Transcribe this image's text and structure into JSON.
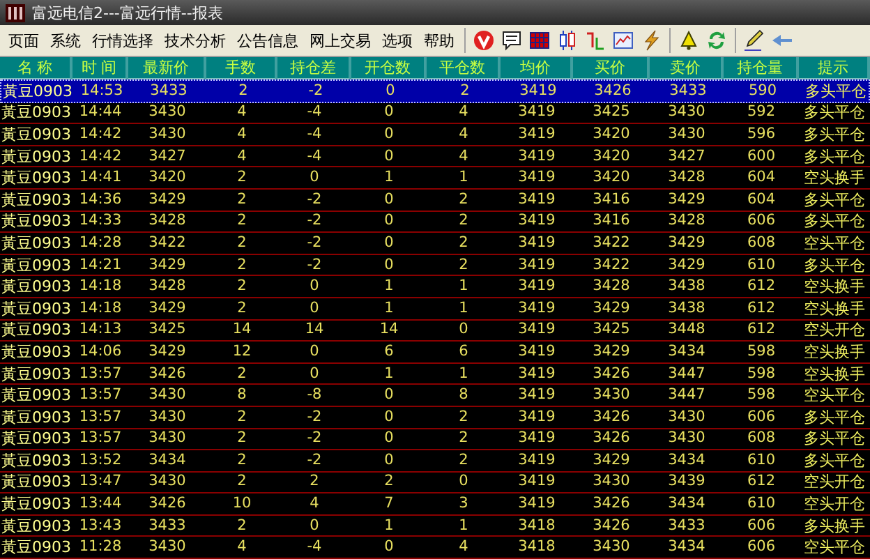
{
  "window": {
    "title": "富远电信2---富远行情--报表"
  },
  "menu": [
    "页面",
    "系统",
    "行情选择",
    "技术分析",
    "公告信息",
    "网上交易",
    "选项",
    "帮助"
  ],
  "table": {
    "columns": [
      "名 称",
      "时 间",
      "最新价",
      "手数",
      "持仓差",
      "开仓数",
      "平仓数",
      "均价",
      "买价",
      "卖价",
      "持仓量",
      "提示"
    ],
    "rows": [
      {
        "selected": true,
        "cells": [
          "黃豆0903",
          "14:53",
          "3433",
          "2",
          "-2",
          "0",
          "2",
          "3419",
          "3426",
          "3433",
          "590",
          "多头平仓"
        ]
      },
      {
        "selected": false,
        "cells": [
          "黃豆0903",
          "14:44",
          "3430",
          "4",
          "-4",
          "0",
          "4",
          "3419",
          "3425",
          "3430",
          "592",
          "多头平仓"
        ]
      },
      {
        "selected": false,
        "cells": [
          "黃豆0903",
          "14:42",
          "3430",
          "4",
          "-4",
          "0",
          "4",
          "3419",
          "3420",
          "3430",
          "596",
          "多头平仓"
        ]
      },
      {
        "selected": false,
        "cells": [
          "黃豆0903",
          "14:42",
          "3427",
          "4",
          "-4",
          "0",
          "4",
          "3419",
          "3420",
          "3427",
          "600",
          "多头平仓"
        ]
      },
      {
        "selected": false,
        "cells": [
          "黃豆0903",
          "14:41",
          "3420",
          "2",
          "0",
          "1",
          "1",
          "3419",
          "3420",
          "3428",
          "604",
          "空头换手"
        ]
      },
      {
        "selected": false,
        "cells": [
          "黃豆0903",
          "14:36",
          "3429",
          "2",
          "-2",
          "0",
          "2",
          "3419",
          "3416",
          "3429",
          "604",
          "多头平仓"
        ]
      },
      {
        "selected": false,
        "cells": [
          "黃豆0903",
          "14:33",
          "3428",
          "2",
          "-2",
          "0",
          "2",
          "3419",
          "3416",
          "3428",
          "606",
          "多头平仓"
        ]
      },
      {
        "selected": false,
        "cells": [
          "黃豆0903",
          "14:28",
          "3422",
          "2",
          "-2",
          "0",
          "2",
          "3419",
          "3422",
          "3429",
          "608",
          "空头平仓"
        ]
      },
      {
        "selected": false,
        "cells": [
          "黃豆0903",
          "14:21",
          "3429",
          "2",
          "-2",
          "0",
          "2",
          "3419",
          "3422",
          "3429",
          "610",
          "多头平仓"
        ]
      },
      {
        "selected": false,
        "cells": [
          "黃豆0903",
          "14:18",
          "3428",
          "2",
          "0",
          "1",
          "1",
          "3419",
          "3428",
          "3438",
          "612",
          "空头换手"
        ]
      },
      {
        "selected": false,
        "cells": [
          "黃豆0903",
          "14:18",
          "3429",
          "2",
          "0",
          "1",
          "1",
          "3419",
          "3429",
          "3438",
          "612",
          "空头换手"
        ]
      },
      {
        "selected": false,
        "cells": [
          "黃豆0903",
          "14:13",
          "3425",
          "14",
          "14",
          "14",
          "0",
          "3419",
          "3425",
          "3448",
          "612",
          "空头开仓"
        ]
      },
      {
        "selected": false,
        "cells": [
          "黃豆0903",
          "14:06",
          "3429",
          "12",
          "0",
          "6",
          "6",
          "3419",
          "3429",
          "3434",
          "598",
          "空头换手"
        ]
      },
      {
        "selected": false,
        "cells": [
          "黃豆0903",
          "13:57",
          "3426",
          "2",
          "0",
          "1",
          "1",
          "3419",
          "3426",
          "3447",
          "598",
          "空头换手"
        ]
      },
      {
        "selected": false,
        "cells": [
          "黃豆0903",
          "13:57",
          "3430",
          "8",
          "-8",
          "0",
          "8",
          "3419",
          "3430",
          "3447",
          "598",
          "空头平仓"
        ]
      },
      {
        "selected": false,
        "cells": [
          "黃豆0903",
          "13:57",
          "3430",
          "2",
          "-2",
          "0",
          "2",
          "3419",
          "3426",
          "3430",
          "606",
          "多头平仓"
        ]
      },
      {
        "selected": false,
        "cells": [
          "黃豆0903",
          "13:57",
          "3430",
          "2",
          "-2",
          "0",
          "2",
          "3419",
          "3426",
          "3430",
          "608",
          "多头平仓"
        ]
      },
      {
        "selected": false,
        "cells": [
          "黃豆0903",
          "13:52",
          "3434",
          "2",
          "-2",
          "0",
          "2",
          "3419",
          "3429",
          "3434",
          "610",
          "多头平仓"
        ]
      },
      {
        "selected": false,
        "cells": [
          "黃豆0903",
          "13:47",
          "3430",
          "2",
          "2",
          "2",
          "0",
          "3419",
          "3430",
          "3439",
          "612",
          "空头开仓"
        ]
      },
      {
        "selected": false,
        "cells": [
          "黃豆0903",
          "13:44",
          "3426",
          "10",
          "4",
          "7",
          "3",
          "3419",
          "3426",
          "3434",
          "610",
          "空头开仓"
        ]
      },
      {
        "selected": false,
        "cells": [
          "黃豆0903",
          "13:43",
          "3433",
          "2",
          "0",
          "1",
          "1",
          "3418",
          "3426",
          "3433",
          "606",
          "多头换手"
        ]
      },
      {
        "selected": false,
        "cells": [
          "黃豆0903",
          "11:28",
          "3430",
          "4",
          "-4",
          "0",
          "4",
          "3418",
          "3430",
          "3434",
          "606",
          "空头平仓"
        ]
      }
    ]
  }
}
